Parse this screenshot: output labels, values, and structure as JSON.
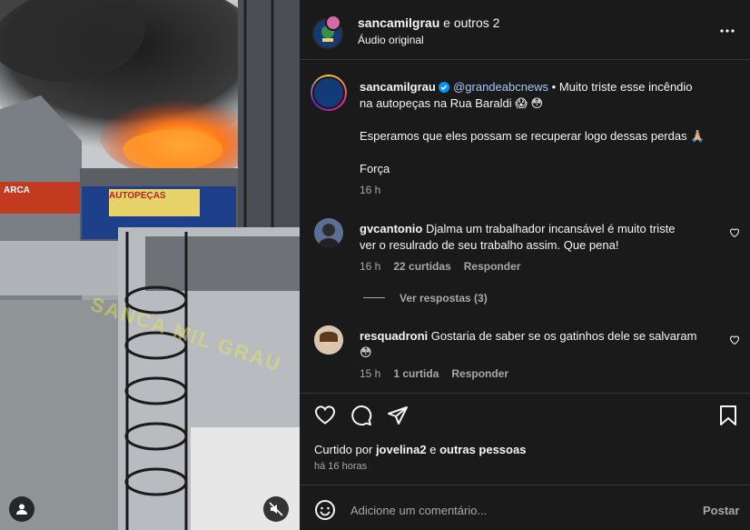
{
  "header": {
    "author": "sancamilgrau",
    "connector": "e outros 2",
    "subtitle": "Áudio original"
  },
  "caption": {
    "author": "sancamilgrau",
    "mention": "@grandeabcnews",
    "line1": " • Muito triste esse incêndio",
    "line2": "na autopeças na Rua Baraldi 😱 😳",
    "para2": "Esperamos que eles possam se recuperar logo dessas perdas 🙏🏼",
    "para3": "Força",
    "time": "16 h"
  },
  "comments": [
    {
      "author": "gvcantonio",
      "text1": "Djalma um trabalhador incansável é muito triste",
      "text2": "ver o resulrado de seu trabalho assim. Que pena!",
      "time": "16 h",
      "likes": "22 curtidas",
      "reply": "Responder",
      "view_replies": "Ver respostas (3)"
    },
    {
      "author": "resquadroni",
      "text1": "Gostaria de saber se os gatinhos dele se salvaram",
      "text2": "😳",
      "time": "15 h",
      "likes": "1 curtida",
      "reply": "Responder"
    }
  ],
  "likes": {
    "prefix": "Curtido por",
    "user": "jovelina2",
    "middle": "e",
    "others": "outras pessoas",
    "time": "há 16 horas"
  },
  "composer": {
    "placeholder": "Adicione um comentário...",
    "post": "Postar"
  },
  "media": {
    "watermark": "SANCA MIL GRAU",
    "sign_left": "ARCA",
    "sign_store": "AUTOPEÇAS"
  },
  "icons": {
    "more": "more-icon",
    "verified": "verified-badge-icon",
    "heart": "heart-icon",
    "comment": "comment-icon",
    "share": "share-icon",
    "save": "bookmark-icon",
    "emoji": "emoji-icon",
    "mute": "mute-icon",
    "user": "user-tag-icon"
  },
  "colors": {
    "panel_bg": "#1a1a1a",
    "link": "#a8c7fa",
    "verified": "#0095f6",
    "post": "#a8a8a8"
  }
}
